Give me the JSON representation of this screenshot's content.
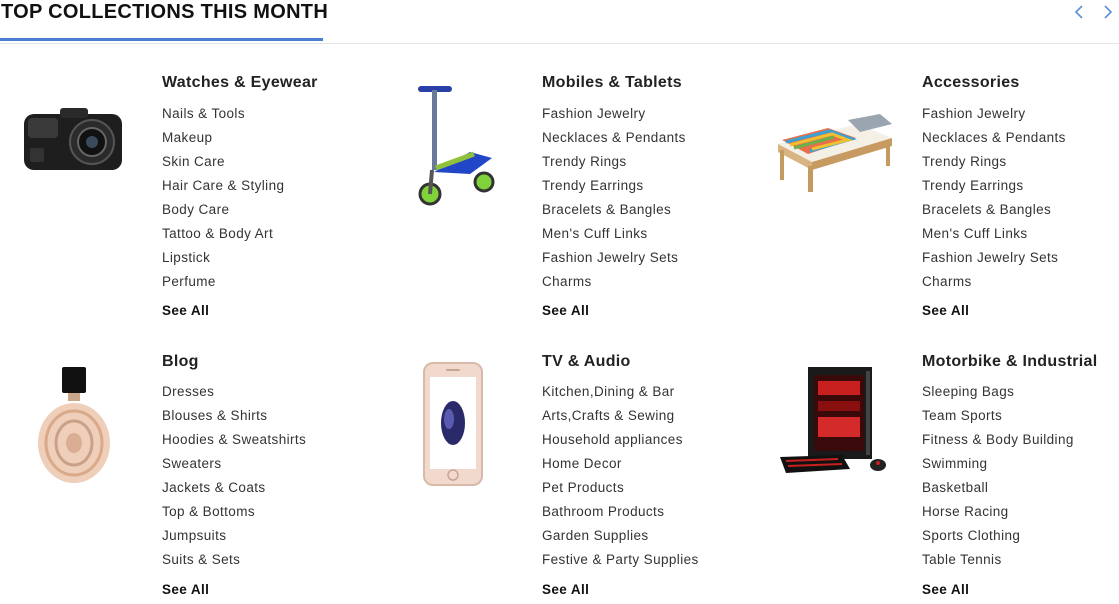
{
  "header": {
    "title": "TOP COLLECTIONS THIS MONTH",
    "prev_icon": "chevron-left-icon",
    "next_icon": "chevron-right-icon",
    "accent_color": "#4a7fd4"
  },
  "collections": [
    {
      "title": "Watches & Eyewear",
      "image": "dash-camera",
      "links": [
        "Nails & Tools",
        "Makeup",
        "Skin Care",
        "Hair Care & Styling",
        "Body Care",
        "Tattoo & Body Art",
        "Lipstick",
        "Perfume"
      ],
      "see_all": "See All"
    },
    {
      "title": "Mobiles & Tablets",
      "image": "kick-scooter",
      "links": [
        "Fashion Jewelry",
        "Necklaces & Pendants",
        "Trendy Rings",
        "Trendy Earrings",
        "Bracelets & Bangles",
        "Men's Cuff Links",
        "Fashion Jewelry Sets",
        "Charms"
      ],
      "see_all": "See All"
    },
    {
      "title": "Accessories",
      "image": "bed",
      "links": [
        "Fashion Jewelry",
        "Necklaces & Pendants",
        "Trendy Rings",
        "Trendy Earrings",
        "Bracelets & Bangles",
        "Men's Cuff Links",
        "Fashion Jewelry Sets",
        "Charms"
      ],
      "see_all": "See All"
    },
    {
      "title": "Blog",
      "image": "perfume-bottle",
      "links": [
        "Dresses",
        "Blouses & Shirts",
        "Hoodies & Sweatshirts",
        "Sweaters",
        "Jackets & Coats",
        "Top & Bottoms",
        "Jumpsuits",
        "Suits & Sets"
      ],
      "see_all": "See All"
    },
    {
      "title": "TV & Audio",
      "image": "smartphone",
      "links": [
        "Kitchen,Dining & Bar",
        "Arts,Crafts & Sewing",
        "Household appliances",
        "Home Decor",
        "Pet Products",
        "Bathroom Products",
        "Garden Supplies",
        "Festive & Party Supplies"
      ],
      "see_all": "See All"
    },
    {
      "title": "Motorbike & Industrial",
      "image": "gaming-pc",
      "links": [
        "Sleeping Bags",
        "Team Sports",
        "Fitness & Body Building",
        "Swimming",
        "Basketball",
        "Horse Racing",
        "Sports Clothing",
        "Table Tennis"
      ],
      "see_all": "See All"
    }
  ]
}
